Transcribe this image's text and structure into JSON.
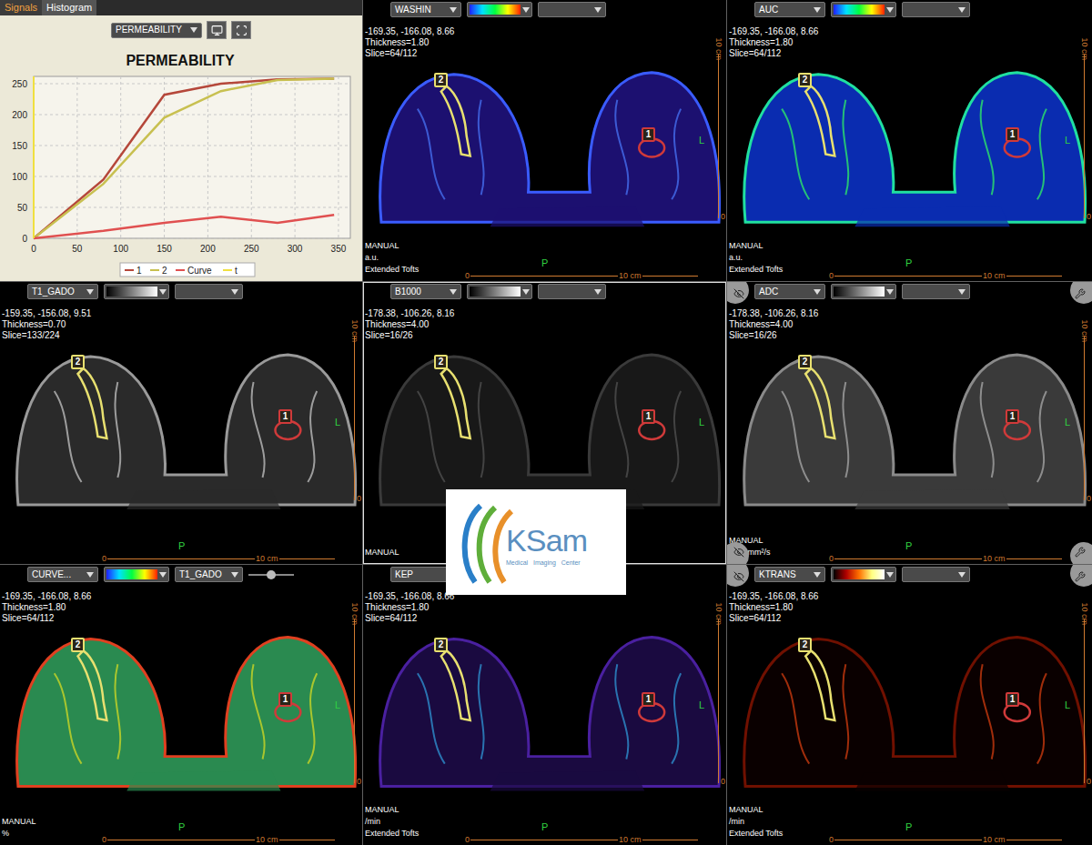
{
  "chart_panel": {
    "tabs": [
      {
        "label": "Signals",
        "selected": true
      },
      {
        "label": "Histogram",
        "selected": false
      }
    ],
    "dropdown": "PERMEABILITY",
    "chart": {
      "title": "PERMEABILITY",
      "y_ticks": [
        "0",
        "50",
        "100",
        "150",
        "200",
        "250"
      ],
      "x_ticks": [
        "0",
        "50",
        "100",
        "150",
        "200",
        "250",
        "300",
        "350"
      ],
      "series": [
        {
          "name": "1",
          "kind": "line",
          "color": "#b5473a",
          "x": [
            0,
            80,
            150,
            215,
            280,
            345
          ],
          "values": [
            0,
            95,
            232,
            250,
            257,
            258
          ]
        },
        {
          "name": "2",
          "kind": "line",
          "color": "#c8c050",
          "x": [
            0,
            80,
            150,
            215,
            280,
            345
          ],
          "values": [
            0,
            88,
            195,
            238,
            256,
            258
          ]
        },
        {
          "name": "Curve",
          "kind": "line",
          "color": "#e05050",
          "x": [
            0,
            80,
            150,
            215,
            280,
            345
          ],
          "values": [
            0,
            12,
            25,
            35,
            25,
            38
          ]
        },
        {
          "name": "t",
          "kind": "marker",
          "color": "#f0e040",
          "x": [
            0
          ],
          "values": []
        }
      ]
    }
  },
  "viewports": [
    {
      "map": "WASHIN",
      "colormap": "rainbow",
      "second_dropdown": "",
      "coords": "-169.35, -166.08, 8.66",
      "thickness": "Thickness=1.80",
      "slice": "Slice=64/112",
      "footer": [
        "MANUAL",
        "a.u.",
        "Extended Tofts"
      ],
      "right": "L",
      "bottom": "P",
      "ruler": {
        "start": "0",
        "end": "10 cm"
      },
      "selected": false,
      "tools": "none"
    },
    {
      "map": "AUC",
      "colormap": "rainbow",
      "second_dropdown": "",
      "coords": "-169.35, -166.08, 8.66",
      "thickness": "Thickness=1.80",
      "slice": "Slice=64/112",
      "footer": [
        "MANUAL",
        "a.u.",
        "Extended Tofts"
      ],
      "right": "L",
      "bottom": "P",
      "ruler": {
        "start": "0",
        "end": "10 cm"
      },
      "selected": false,
      "tools": "none"
    },
    {
      "map": "T1_GADO",
      "colormap": "gray",
      "second_dropdown": "",
      "coords": "-159.35, -156.08, 9.51",
      "thickness": "Thickness=0.70",
      "slice": "Slice=133/224",
      "footer": [],
      "right": "L",
      "bottom": "P",
      "ruler": {
        "start": "0",
        "end": "10 cm"
      },
      "selected": false,
      "tools": "none"
    },
    {
      "map": "B1000",
      "colormap": "gray",
      "second_dropdown": "",
      "coords": "-178.38, -106.26, 8.16",
      "thickness": "Thickness=4.00",
      "slice": "Slice=16/26",
      "footer": [
        "MANUAL"
      ],
      "right": "L",
      "bottom": "",
      "ruler": {
        "start": "",
        "end": ""
      },
      "selected": true,
      "tools": "none"
    },
    {
      "map": "ADC",
      "colormap": "gray",
      "second_dropdown": "",
      "coords": "-178.38, -106.26, 8.16",
      "thickness": "Thickness=4.00",
      "slice": "Slice=16/26",
      "footer": [
        "MANUAL",
        "1e-3 mm²/s"
      ],
      "right": "L",
      "bottom": "P",
      "ruler": {
        "start": "0",
        "end": "10 cm"
      },
      "selected": false,
      "tools": "all"
    },
    {
      "map": "CURVE...",
      "colormap": "rainbow",
      "second_dropdown": "T1_GADO",
      "slider": {
        "level": 0.5
      },
      "coords": "-169.35, -166.08, 8.66",
      "thickness": "Thickness=1.80",
      "slice": "Slice=64/112",
      "footer": [
        "MANUAL",
        "%"
      ],
      "right": "L",
      "bottom": "P",
      "ruler": {
        "start": "0",
        "end": "10 cm"
      },
      "selected": false,
      "tools": "none"
    },
    {
      "map": "KEP",
      "colormap": "none",
      "coords": "-169.35, -166.08, 8.66",
      "thickness": "Thickness=1.80",
      "slice": "Slice=64/112",
      "footer": [
        "MANUAL",
        "/min",
        "Extended Tofts"
      ],
      "right": "L",
      "bottom": "P",
      "ruler": {
        "start": "0",
        "end": "10 cm"
      },
      "selected": false,
      "tools": "none"
    },
    {
      "map": "KTRANS",
      "colormap": "hot",
      "second_dropdown": "",
      "coords": "-169.35, -166.08, 8.66",
      "thickness": "Thickness=1.80",
      "slice": "Slice=64/112",
      "footer": [
        "MANUAL",
        "/min",
        "Extended Tofts"
      ],
      "right": "L",
      "bottom": "P",
      "ruler": {
        "start": "0",
        "end": "10 cm"
      },
      "selected": false,
      "tools": "top"
    }
  ],
  "rois": [
    {
      "label": "2",
      "color": "#e8e070"
    },
    {
      "label": "1",
      "color": "#d03a3a"
    }
  ],
  "logo": {
    "name": "KSam",
    "subtitle": "Medical   Imaging   Center"
  }
}
